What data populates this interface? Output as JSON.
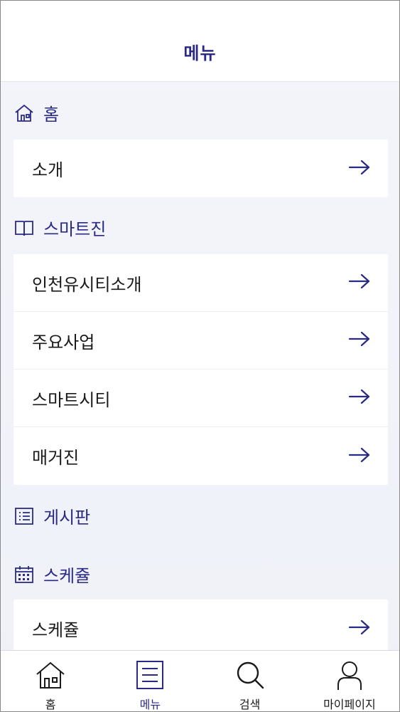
{
  "header": {
    "title": "메뉴"
  },
  "sections": {
    "home": {
      "title": "홈",
      "icon": "house-icon",
      "items": [
        {
          "label": "소개"
        }
      ]
    },
    "smartzine": {
      "title": "스마트진",
      "icon": "book-icon",
      "items": [
        {
          "label": "인천유시티소개"
        },
        {
          "label": "주요사업"
        },
        {
          "label": "스마트시티"
        },
        {
          "label": "매거진"
        }
      ]
    },
    "board": {
      "title": "게시판",
      "icon": "list-icon"
    },
    "schedule": {
      "title": "스케쥴",
      "icon": "calendar-icon",
      "items": [
        {
          "label": "스케쥴"
        }
      ]
    }
  },
  "tabbar": [
    {
      "label": "홈",
      "icon": "house-icon",
      "active": false
    },
    {
      "label": "메뉴",
      "icon": "menu-list-icon",
      "active": true
    },
    {
      "label": "검색",
      "icon": "search-icon",
      "active": false
    },
    {
      "label": "마이페이지",
      "icon": "person-icon",
      "active": false
    }
  ],
  "colors": {
    "accent": "#2a2a86",
    "background": "#f1f2f8",
    "card": "#ffffff"
  }
}
